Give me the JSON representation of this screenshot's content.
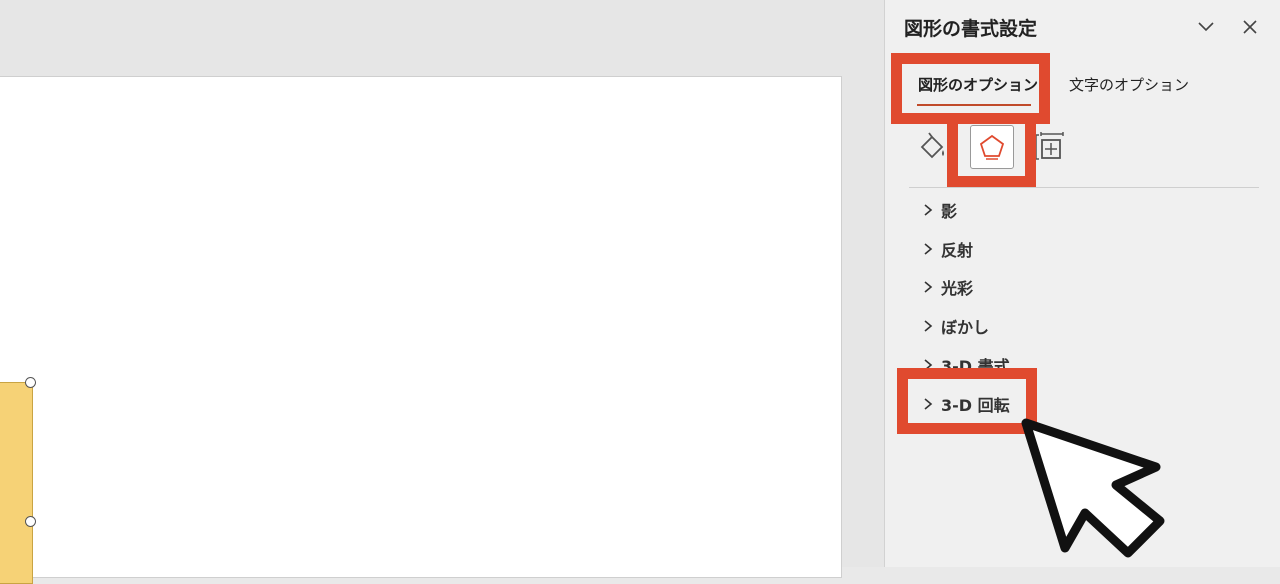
{
  "pane": {
    "title": "図形の書式設定",
    "tabs": [
      {
        "label": "図形のオプション",
        "active": true
      },
      {
        "label": "文字のオプション",
        "active": false
      }
    ],
    "icon_tabs": [
      {
        "icon": "fill-bucket-icon"
      },
      {
        "icon": "pentagon-effects-icon",
        "selected": true
      },
      {
        "icon": "size-layout-icon"
      }
    ],
    "sections": [
      {
        "label": "影"
      },
      {
        "label": "反射"
      },
      {
        "label": "光彩"
      },
      {
        "label": "ぼかし"
      },
      {
        "label": "3-D 書式"
      },
      {
        "label": "3-D 回転"
      }
    ]
  },
  "colors": {
    "highlight": "#e04a2f",
    "accent": "#c04a2a",
    "shape_fill": "#f6d276"
  }
}
